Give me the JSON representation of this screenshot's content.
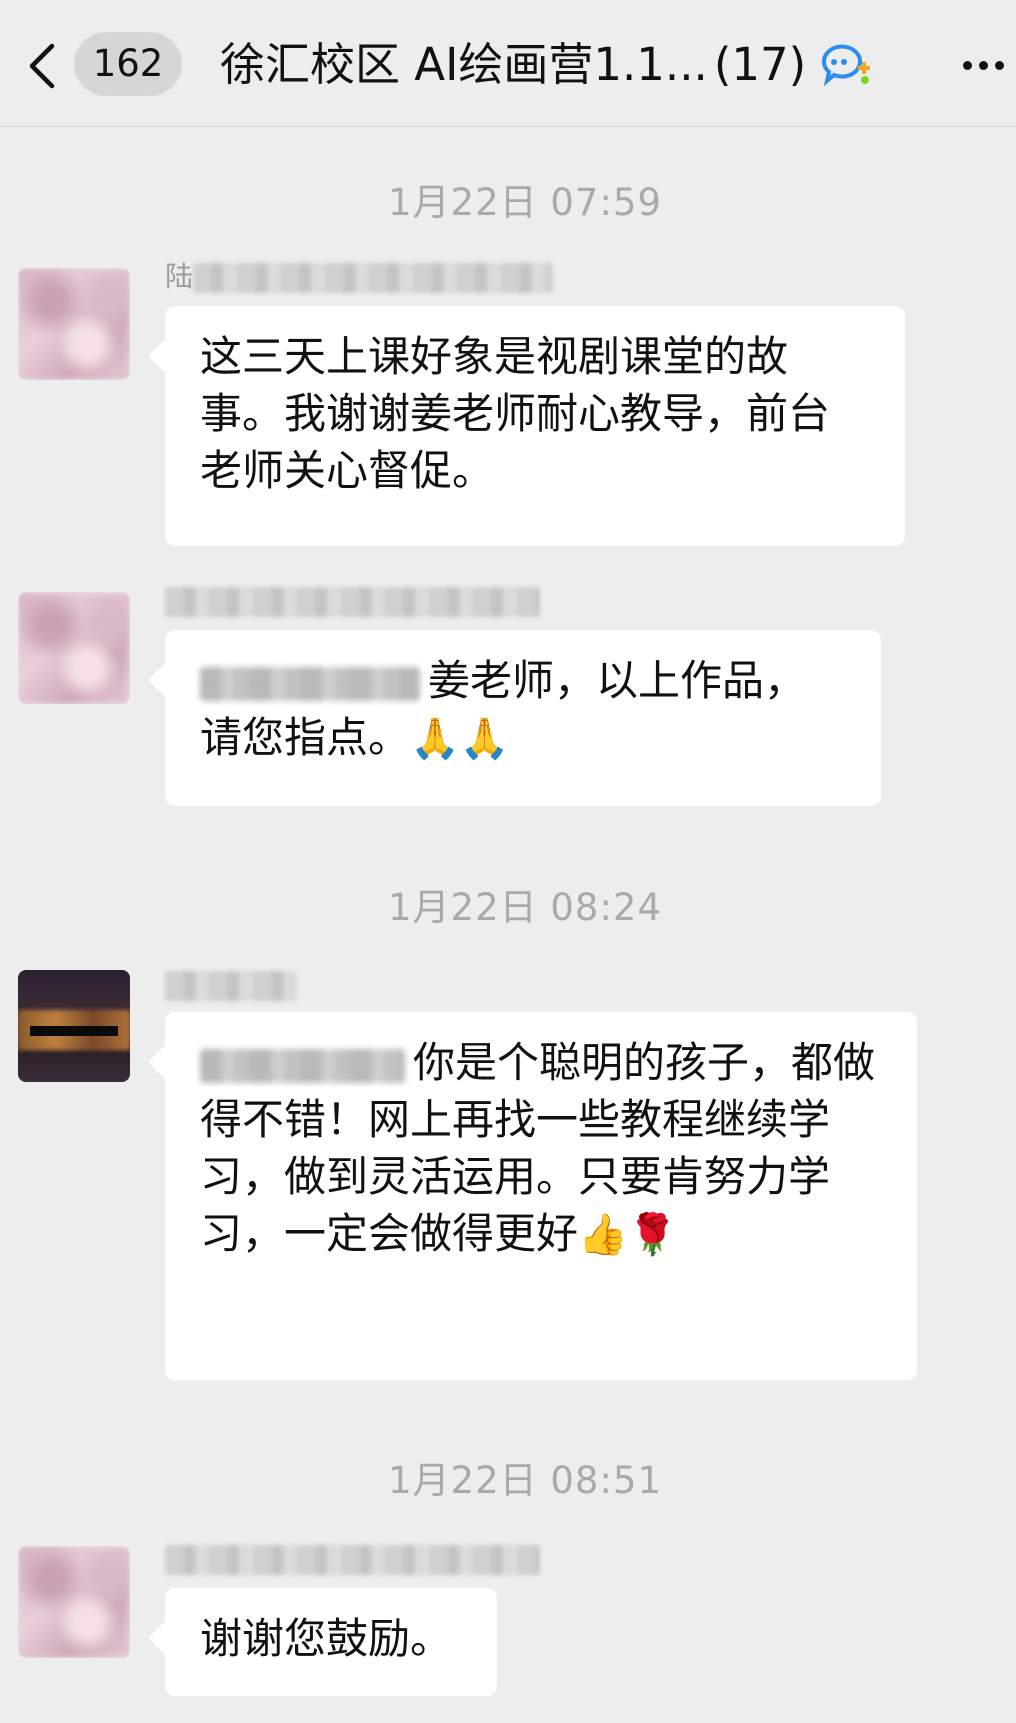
{
  "header": {
    "back_icon": "chevron-left-icon",
    "unread_count": "162",
    "title": "徐汇校区 AI绘画营1.1...",
    "member_count": "(17)",
    "group_icon": "group-chat-icon",
    "more_icon": "more-dots-icon"
  },
  "timestamps": [
    "1月22日 07:59",
    "1月22日 08:24",
    "1月22日 08:51"
  ],
  "messages": [
    {
      "sender_visible_prefix": "陆",
      "text": "这三天上课好象是视剧课堂的故事。我谢谢姜老师耐心教导，前台老师关心督促。"
    },
    {
      "sender_visible_prefix": "",
      "text": "姜老师，以上作品，请您指点。",
      "emojis": "🙏🙏"
    },
    {
      "sender_visible_prefix": "",
      "text": "你是个聪明的孩子，都做得不错！网上再找一些教程继续学习，做到灵活运用。只要肯努力学习，一定会做得更好",
      "emojis": "👍🌹"
    },
    {
      "sender_visible_prefix": "",
      "text": "谢谢您鼓励。"
    }
  ]
}
